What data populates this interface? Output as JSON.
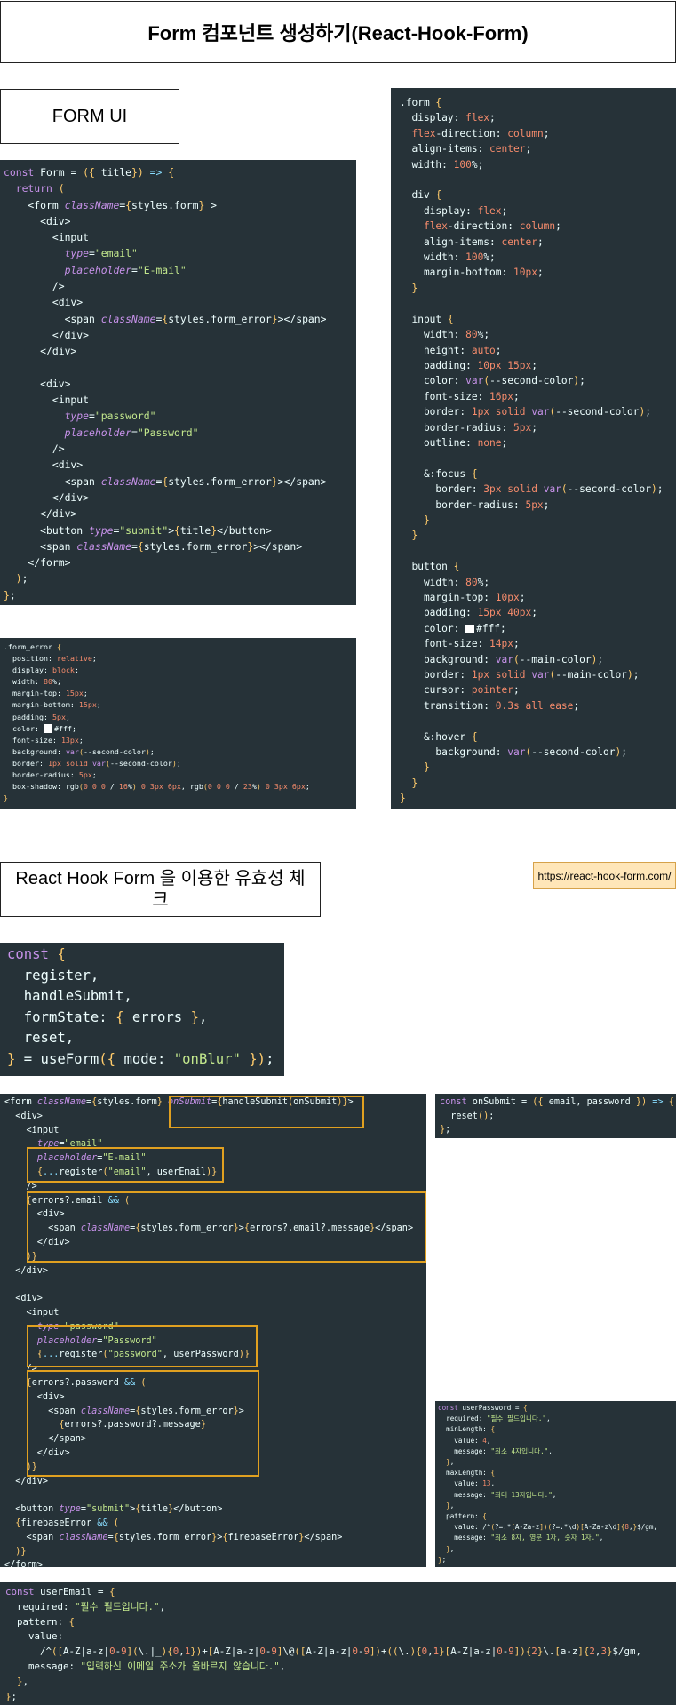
{
  "header": {
    "title": "Form 컴포넌트 생성하기(React-Hook-Form)"
  },
  "section1": {
    "label": "FORM UI"
  },
  "section2": {
    "label": "React Hook Form 을 이용한 유효성 체크",
    "link": "https://react-hook-form.com/"
  },
  "code_blocks": {
    "form_jsx": [
      "const Form = ({ title}) => {",
      "  return (",
      "    <form className={styles.form} >",
      "      <div>",
      "        <input",
      "          type=\"email\"",
      "          placeholder=\"E-mail\"",
      "        />",
      "        <div>",
      "          <span className={styles.form_error}></span>",
      "        </div>",
      "      </div>",
      "",
      "      <div>",
      "        <input",
      "          type=\"password\"",
      "          placeholder=\"Password\"",
      "        />",
      "        <div>",
      "          <span className={styles.form_error}></span>",
      "        </div>",
      "      </div>",
      "      <button type=\"submit\">{title}</button>",
      "      <span className={styles.form_error}></span>",
      "    </form>",
      "  );",
      "};"
    ],
    "form_error_css": [
      ".form_error {",
      "  position: relative;",
      "  display: block;",
      "  width: 80%;",
      "  margin-top: 15px;",
      "  margin-bottom: 15px;",
      "  padding: 5px;",
      "  color: #fff;",
      "  font-size: 13px;",
      "  background: var(--second-color);",
      "  border: 1px solid var(--second-color);",
      "  border-radius: 5px;",
      "  box-shadow: rgb(0 0 0 / 16%) 0 3px 6px, rgb(0 0 0 / 23%) 0 3px 6px;",
      "}"
    ],
    "form_css": [
      ".form {",
      "  display: flex;",
      "  flex-direction: column;",
      "  align-items: center;",
      "  width: 100%;",
      "",
      "  div {",
      "    display: flex;",
      "    flex-direction: column;",
      "    align-items: center;",
      "    width: 100%;",
      "    margin-bottom: 10px;",
      "  }",
      "",
      "  input {",
      "    width: 80%;",
      "    height: auto;",
      "    padding: 10px 15px;",
      "    color: var(--second-color);",
      "    font-size: 16px;",
      "    border: 1px solid var(--second-color);",
      "    border-radius: 5px;",
      "    outline: none;",
      "",
      "    &:focus {",
      "      border: 3px solid var(--second-color);",
      "      border-radius: 5px;",
      "    }",
      "  }",
      "",
      "  button {",
      "    width: 80%;",
      "    margin-top: 10px;",
      "    padding: 15px 40px;",
      "    color: #fff;",
      "    font-size: 14px;",
      "    background: var(--main-color);",
      "    border: 1px solid var(--main-color);",
      "    cursor: pointer;",
      "    transition: 0.3s all ease;",
      "",
      "    &:hover {",
      "      background: var(--second-color);",
      "    }",
      "  }",
      "}"
    ],
    "use_form": [
      "const {",
      "  register,",
      "  handleSubmit,",
      "  formState: { errors },",
      "  reset,",
      "} = useForm({ mode: \"onBlur\" });"
    ],
    "rhf_jsx": [
      "<form className={styles.form} onSubmit={handleSubmit(onSubmit)}>",
      "  <div>",
      "    <input",
      "      type=\"email\"",
      "      placeholder=\"E-mail\"",
      "      {...register(\"email\", userEmail)}",
      "    />",
      "    {errors?.email && (",
      "      <div>",
      "        <span className={styles.form_error}>{errors?.email?.message}</span>",
      "      </div>",
      "    )}",
      "  </div>",
      "",
      "  <div>",
      "    <input",
      "      type=\"password\"",
      "      placeholder=\"Password\"",
      "      {...register(\"password\", userPassword)}",
      "    />",
      "    {errors?.password && (",
      "      <div>",
      "        <span className={styles.form_error}>",
      "          {errors?.password?.message}",
      "        </span>",
      "      </div>",
      "    )}",
      "  </div>",
      "",
      "  <button type=\"submit\">{title}</button>",
      "  {firebaseError && (",
      "    <span className={styles.form_error}>{firebaseError}</span>",
      "  )}",
      "</form>"
    ],
    "on_submit": [
      "const onSubmit = ({ email, password }) => {",
      "  reset();",
      "};"
    ],
    "user_password": [
      "const userPassword = {",
      "  required: \"필수 필드입니다.\",",
      "  minLength: {",
      "    value: 4,",
      "    message: \"최소 4자입니다.\",",
      "  },",
      "  maxLength: {",
      "    value: 13,",
      "    message: \"최대 13자입니다.\",",
      "  },",
      "  pattern: {",
      "    value: /^(?=.*[A-Za-z])(?=.*\\d)[A-Za-z\\d]{8,}$/gm,",
      "    message: \"최소 8자, 영문 1자, 숫자 1자.\",",
      "  },",
      "};"
    ],
    "user_email": [
      "const userEmail = {",
      "  required: \"필수 필드입니다.\",",
      "  pattern: {",
      "    value:",
      "      /^([A-Z|a-z|0-9](\\.|_){0,1})+[A-Z|a-z|0-9]\\@([A-Z|a-z|0-9])+((\\.){0,1}[A-Z|a-z|0-9]){2}\\.[a-z]{2,3}$/gm,",
      "    message: \"입력하신 이메일 주소가 올바르지 않습니다.\",",
      "  },",
      "};"
    ]
  },
  "colors": {
    "code_bg": "#263238",
    "highlight": "#e0a020",
    "link_bg": "#ffe6b8"
  }
}
